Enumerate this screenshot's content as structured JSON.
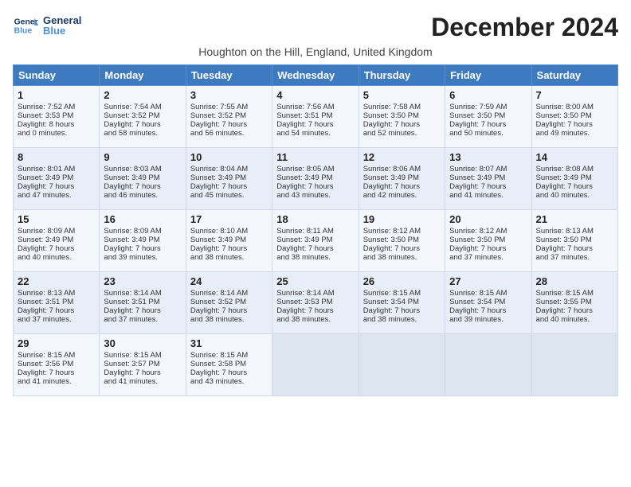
{
  "header": {
    "logo_line1": "General",
    "logo_line2": "Blue",
    "month_title": "December 2024",
    "subtitle": "Houghton on the Hill, England, United Kingdom"
  },
  "columns": [
    "Sunday",
    "Monday",
    "Tuesday",
    "Wednesday",
    "Thursday",
    "Friday",
    "Saturday"
  ],
  "weeks": [
    [
      {
        "day": "1",
        "lines": [
          "Sunrise: 7:52 AM",
          "Sunset: 3:53 PM",
          "Daylight: 8 hours",
          "and 0 minutes."
        ]
      },
      {
        "day": "2",
        "lines": [
          "Sunrise: 7:54 AM",
          "Sunset: 3:52 PM",
          "Daylight: 7 hours",
          "and 58 minutes."
        ]
      },
      {
        "day": "3",
        "lines": [
          "Sunrise: 7:55 AM",
          "Sunset: 3:52 PM",
          "Daylight: 7 hours",
          "and 56 minutes."
        ]
      },
      {
        "day": "4",
        "lines": [
          "Sunrise: 7:56 AM",
          "Sunset: 3:51 PM",
          "Daylight: 7 hours",
          "and 54 minutes."
        ]
      },
      {
        "day": "5",
        "lines": [
          "Sunrise: 7:58 AM",
          "Sunset: 3:50 PM",
          "Daylight: 7 hours",
          "and 52 minutes."
        ]
      },
      {
        "day": "6",
        "lines": [
          "Sunrise: 7:59 AM",
          "Sunset: 3:50 PM",
          "Daylight: 7 hours",
          "and 50 minutes."
        ]
      },
      {
        "day": "7",
        "lines": [
          "Sunrise: 8:00 AM",
          "Sunset: 3:50 PM",
          "Daylight: 7 hours",
          "and 49 minutes."
        ]
      }
    ],
    [
      {
        "day": "8",
        "lines": [
          "Sunrise: 8:01 AM",
          "Sunset: 3:49 PM",
          "Daylight: 7 hours",
          "and 47 minutes."
        ]
      },
      {
        "day": "9",
        "lines": [
          "Sunrise: 8:03 AM",
          "Sunset: 3:49 PM",
          "Daylight: 7 hours",
          "and 46 minutes."
        ]
      },
      {
        "day": "10",
        "lines": [
          "Sunrise: 8:04 AM",
          "Sunset: 3:49 PM",
          "Daylight: 7 hours",
          "and 45 minutes."
        ]
      },
      {
        "day": "11",
        "lines": [
          "Sunrise: 8:05 AM",
          "Sunset: 3:49 PM",
          "Daylight: 7 hours",
          "and 43 minutes."
        ]
      },
      {
        "day": "12",
        "lines": [
          "Sunrise: 8:06 AM",
          "Sunset: 3:49 PM",
          "Daylight: 7 hours",
          "and 42 minutes."
        ]
      },
      {
        "day": "13",
        "lines": [
          "Sunrise: 8:07 AM",
          "Sunset: 3:49 PM",
          "Daylight: 7 hours",
          "and 41 minutes."
        ]
      },
      {
        "day": "14",
        "lines": [
          "Sunrise: 8:08 AM",
          "Sunset: 3:49 PM",
          "Daylight: 7 hours",
          "and 40 minutes."
        ]
      }
    ],
    [
      {
        "day": "15",
        "lines": [
          "Sunrise: 8:09 AM",
          "Sunset: 3:49 PM",
          "Daylight: 7 hours",
          "and 40 minutes."
        ]
      },
      {
        "day": "16",
        "lines": [
          "Sunrise: 8:09 AM",
          "Sunset: 3:49 PM",
          "Daylight: 7 hours",
          "and 39 minutes."
        ]
      },
      {
        "day": "17",
        "lines": [
          "Sunrise: 8:10 AM",
          "Sunset: 3:49 PM",
          "Daylight: 7 hours",
          "and 38 minutes."
        ]
      },
      {
        "day": "18",
        "lines": [
          "Sunrise: 8:11 AM",
          "Sunset: 3:49 PM",
          "Daylight: 7 hours",
          "and 38 minutes."
        ]
      },
      {
        "day": "19",
        "lines": [
          "Sunrise: 8:12 AM",
          "Sunset: 3:50 PM",
          "Daylight: 7 hours",
          "and 38 minutes."
        ]
      },
      {
        "day": "20",
        "lines": [
          "Sunrise: 8:12 AM",
          "Sunset: 3:50 PM",
          "Daylight: 7 hours",
          "and 37 minutes."
        ]
      },
      {
        "day": "21",
        "lines": [
          "Sunrise: 8:13 AM",
          "Sunset: 3:50 PM",
          "Daylight: 7 hours",
          "and 37 minutes."
        ]
      }
    ],
    [
      {
        "day": "22",
        "lines": [
          "Sunrise: 8:13 AM",
          "Sunset: 3:51 PM",
          "Daylight: 7 hours",
          "and 37 minutes."
        ]
      },
      {
        "day": "23",
        "lines": [
          "Sunrise: 8:14 AM",
          "Sunset: 3:51 PM",
          "Daylight: 7 hours",
          "and 37 minutes."
        ]
      },
      {
        "day": "24",
        "lines": [
          "Sunrise: 8:14 AM",
          "Sunset: 3:52 PM",
          "Daylight: 7 hours",
          "and 38 minutes."
        ]
      },
      {
        "day": "25",
        "lines": [
          "Sunrise: 8:14 AM",
          "Sunset: 3:53 PM",
          "Daylight: 7 hours",
          "and 38 minutes."
        ]
      },
      {
        "day": "26",
        "lines": [
          "Sunrise: 8:15 AM",
          "Sunset: 3:54 PM",
          "Daylight: 7 hours",
          "and 38 minutes."
        ]
      },
      {
        "day": "27",
        "lines": [
          "Sunrise: 8:15 AM",
          "Sunset: 3:54 PM",
          "Daylight: 7 hours",
          "and 39 minutes."
        ]
      },
      {
        "day": "28",
        "lines": [
          "Sunrise: 8:15 AM",
          "Sunset: 3:55 PM",
          "Daylight: 7 hours",
          "and 40 minutes."
        ]
      }
    ],
    [
      {
        "day": "29",
        "lines": [
          "Sunrise: 8:15 AM",
          "Sunset: 3:56 PM",
          "Daylight: 7 hours",
          "and 41 minutes."
        ]
      },
      {
        "day": "30",
        "lines": [
          "Sunrise: 8:15 AM",
          "Sunset: 3:57 PM",
          "Daylight: 7 hours",
          "and 41 minutes."
        ]
      },
      {
        "day": "31",
        "lines": [
          "Sunrise: 8:15 AM",
          "Sunset: 3:58 PM",
          "Daylight: 7 hours",
          "and 43 minutes."
        ]
      },
      null,
      null,
      null,
      null
    ]
  ]
}
